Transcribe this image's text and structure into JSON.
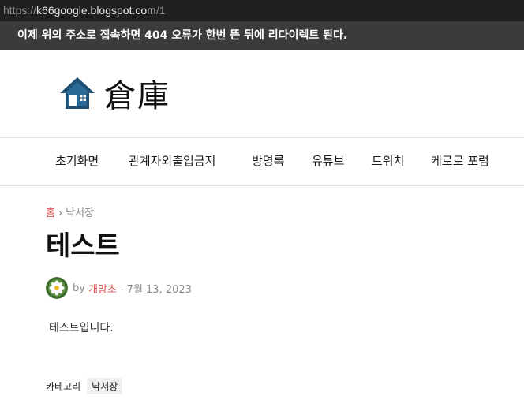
{
  "browser": {
    "url_scheme": "https://",
    "url_host": "k66google.blogspot.com",
    "url_path": "/1"
  },
  "notice": {
    "text": "이제 위의 주소로 접속하면 404 오류가 한번 뜬 뒤에 리다이렉트 된다."
  },
  "site": {
    "logo_text": "倉庫",
    "logo_icon": "house-icon"
  },
  "nav": {
    "items": [
      "초기화면",
      "관계자외출입금지",
      "방명록",
      "유튜브",
      "트위치",
      "케로로 포럼"
    ]
  },
  "breadcrumb": {
    "home": "홈",
    "separator": "›",
    "current": "낙서장"
  },
  "post": {
    "title": "테스트",
    "by": "by",
    "author": "개망초",
    "date": "- 7월 13, 2023",
    "body": "테스트입니다.",
    "category_label": "카테고리",
    "category_tag": "낙서장"
  },
  "colors": {
    "accent": "#d9534f",
    "notice_bg": "#3b3b3b",
    "logo_blue": "#1f4e73"
  }
}
